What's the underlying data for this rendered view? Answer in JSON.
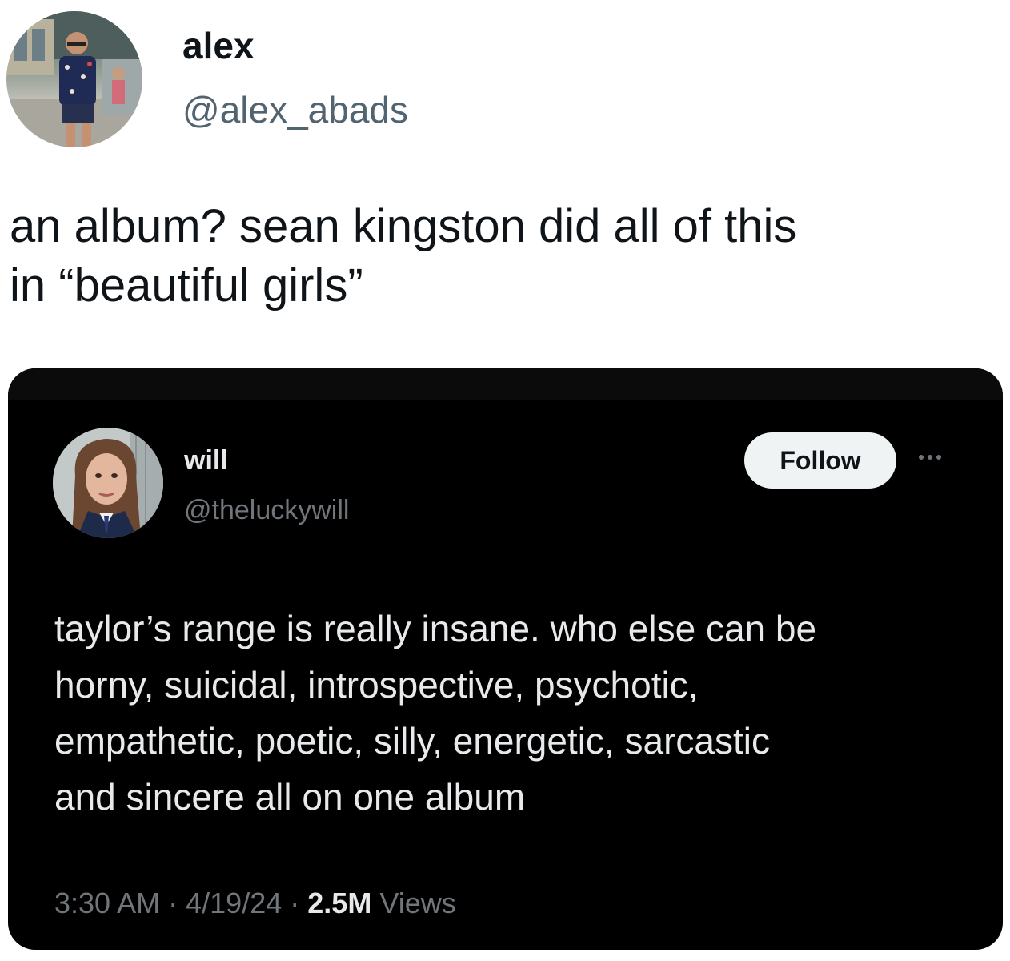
{
  "outer_tweet": {
    "display_name": "alex",
    "handle": "@alex_abads",
    "text_line1": "an album? sean kingston did all of this",
    "text_line2": "in “beautiful girls”"
  },
  "quoted_screenshot": {
    "display_name": "will",
    "handle": "@theluckywill",
    "follow_label": "Follow",
    "more_icon": "more-horizontal-icon",
    "text_lines": [
      "taylor’s range is really insane. who else can be",
      "horny, suicidal, introspective, psychotic,",
      "empathetic, poetic, silly, energetic, sarcastic",
      "and sincere all on one album"
    ],
    "time": "3:30 AM",
    "separator": "·",
    "date": "4/19/24",
    "views_count": "2.5M",
    "views_label": "Views"
  },
  "colors": {
    "background": "#ffffff",
    "text_primary": "#0f1419",
    "text_secondary": "#536471",
    "card_background": "#000000",
    "card_text": "#e7e9ea",
    "card_secondary": "#71767b",
    "follow_button_bg": "#eff3f4"
  }
}
